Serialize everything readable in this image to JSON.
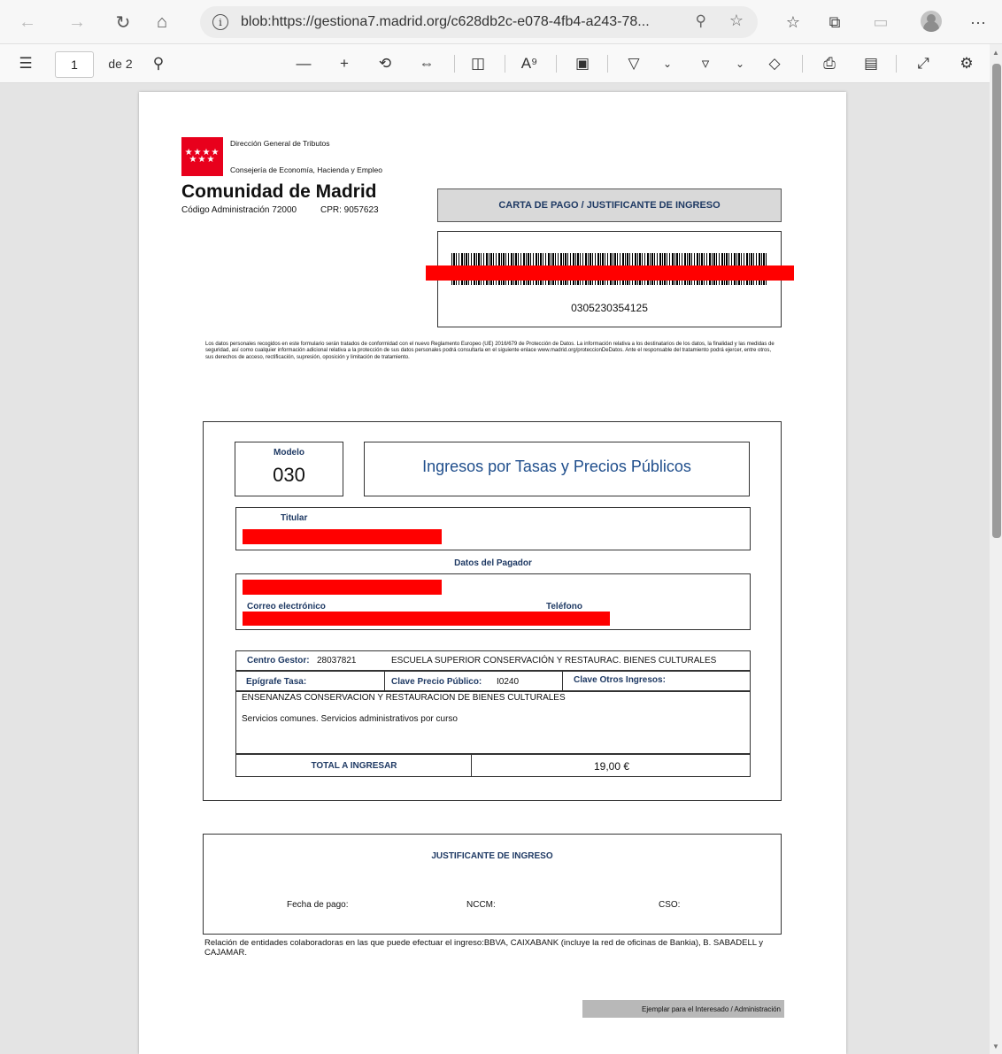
{
  "browser": {
    "url": "blob:https://gestiona7.madrid.org/c628db2c-e078-4fb4-a243-78...",
    "more_label": "···"
  },
  "pdf_toolbar": {
    "current_page": "1",
    "page_count_label": "de 2"
  },
  "doc": {
    "header": {
      "logo_stars": "★★★★\n★★★",
      "direccion": "Dirección General de Tributos",
      "consejeria": "Consejería de Economía, Hacienda y Empleo",
      "organismo": "Comunidad de Madrid",
      "codigo": "Código Administración 72000",
      "cpr": "CPR: 9057623"
    },
    "carta_title": "CARTA DE PAGO / JUSTIFICANTE DE INGRESO",
    "barcode_number": "0305230354125",
    "legal_text": "Los datos personales recogidos en este formulario serán tratados de conformidad con el nuevo Reglamento Europeo (UE) 2016/679 de Protección de Datos. La información relativa a los destinatarios de los datos, la finalidad y las medidas de seguridad, así como cualquier información adicional relativa a la protección de sus datos personales podrá consultarla en el siguiente enlace www.madrid.org/proteccionDeDatos. Ante el responsable del tratamiento podrá ejercer, entre otros, sus derechos de acceso, rectificación, supresión, oposición y limitación de tratamiento.",
    "modelo_label": "Modelo",
    "modelo_number": "030",
    "modelo_title": "Ingresos por Tasas y Precios Públicos",
    "titular_label": "Titular",
    "pagador_label": "Datos del Pagador",
    "correo_label": "Correo electrónico",
    "telefono_label": "Teléfono",
    "centro_gestor_label": "Centro Gestor:",
    "centro_gestor_code": "28037821",
    "centro_gestor_name": "ESCUELA SUPERIOR CONSERVACIÓN Y RESTAURAC. BIENES CULTURALES",
    "epigrafe_label": "Epígrafe Tasa:",
    "clave_precio_label": "Clave Precio Público:",
    "clave_precio_value": "I0240",
    "clave_otros_label": "Clave Otros Ingresos:",
    "concepto_line1": "ENSENANZAS CONSERVACION Y RESTAURACION DE BIENES CULTURALES",
    "concepto_line2": "Servicios comunes. Servicios administrativos por curso",
    "total_label": "TOTAL A INGRESAR",
    "total_value": "19,00 €",
    "justificante_title": "JUSTIFICANTE DE INGRESO",
    "fecha_pago_label": "Fecha de pago:",
    "nccm_label": "NCCM:",
    "cso_label": "CSO:",
    "entidades_text": "Relación de entidades colaboradoras en las que puede efectuar el ingreso:BBVA, CAIXABANK (incluye la red de oficinas de Bankia), B. SABADELL y CAJAMAR.",
    "ejemplar_label": "Ejemplar para el Interesado / Administración"
  }
}
